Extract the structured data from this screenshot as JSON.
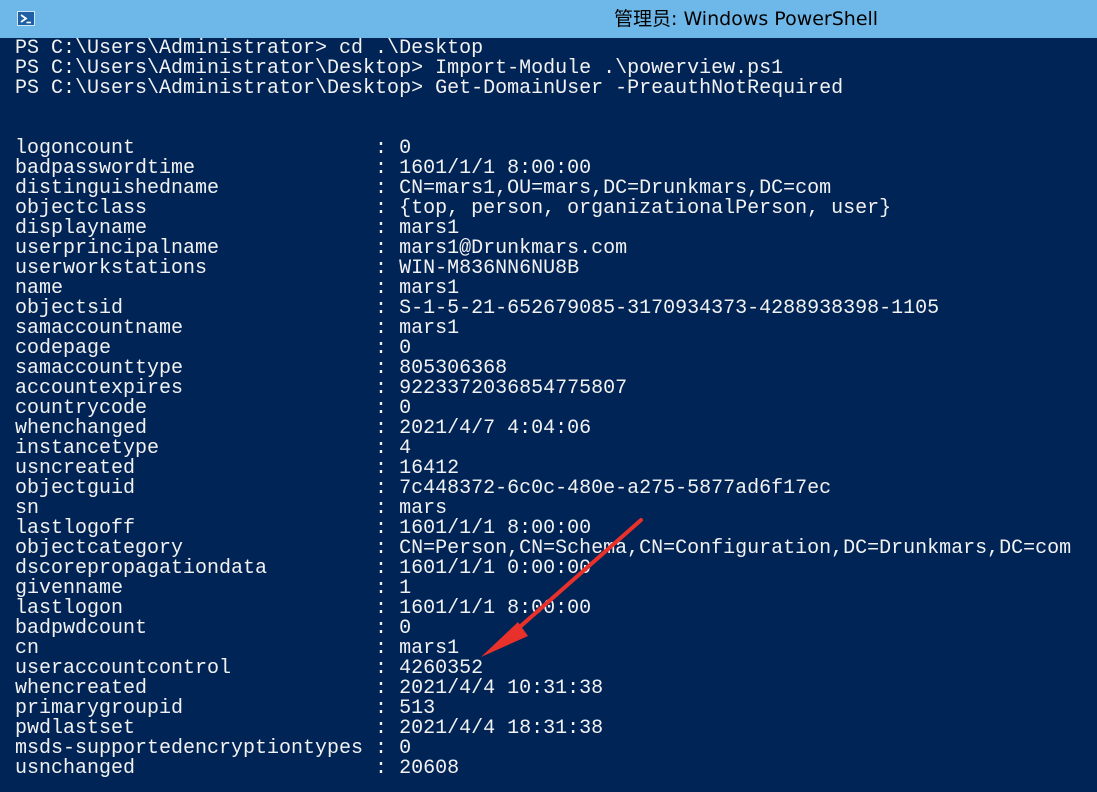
{
  "window": {
    "title": "管理员: Windows PowerShell",
    "icon": "powershell-icon"
  },
  "console": {
    "lines": [
      "PS C:\\Users\\Administrator> cd .\\Desktop",
      "PS C:\\Users\\Administrator\\Desktop> Import-Module .\\powerview.ps1",
      "PS C:\\Users\\Administrator\\Desktop> Get-DomainUser -PreauthNotRequired",
      "",
      "",
      "logoncount                    : 0",
      "badpasswordtime               : 1601/1/1 8:00:00",
      "distinguishedname             : CN=mars1,OU=mars,DC=Drunkmars,DC=com",
      "objectclass                   : {top, person, organizationalPerson, user}",
      "displayname                   : mars1",
      "userprincipalname             : mars1@Drunkmars.com",
      "userworkstations              : WIN-M836NN6NU8B",
      "name                          : mars1",
      "objectsid                     : S-1-5-21-652679085-3170934373-4288938398-1105",
      "samaccountname                : mars1",
      "codepage                      : 0",
      "samaccounttype                : 805306368",
      "accountexpires                : 9223372036854775807",
      "countrycode                   : 0",
      "whenchanged                   : 2021/4/7 4:04:06",
      "instancetype                  : 4",
      "usncreated                    : 16412",
      "objectguid                    : 7c448372-6c0c-480e-a275-5877ad6f17ec",
      "sn                            : mars",
      "lastlogoff                    : 1601/1/1 8:00:00",
      "objectcategory                : CN=Person,CN=Schema,CN=Configuration,DC=Drunkmars,DC=com",
      "dscorepropagationdata         : 1601/1/1 0:00:00",
      "givenname                     : 1",
      "lastlogon                     : 1601/1/1 8:00:00",
      "badpwdcount                   : 0",
      "cn                            : mars1",
      "useraccountcontrol            : 4260352",
      "whencreated                   : 2021/4/4 10:31:38",
      "primarygroupid                : 513",
      "pwdlastset                    : 2021/4/4 18:31:38",
      "msds-supportedencryptiontypes : 0",
      "usnchanged                    : 20608"
    ]
  },
  "annotation": {
    "type": "red-arrow-icon",
    "color": "#e8312a"
  },
  "colors": {
    "titlebar": "#6db8e8",
    "console_background": "#012456",
    "console_text": "#f2f2f2"
  }
}
